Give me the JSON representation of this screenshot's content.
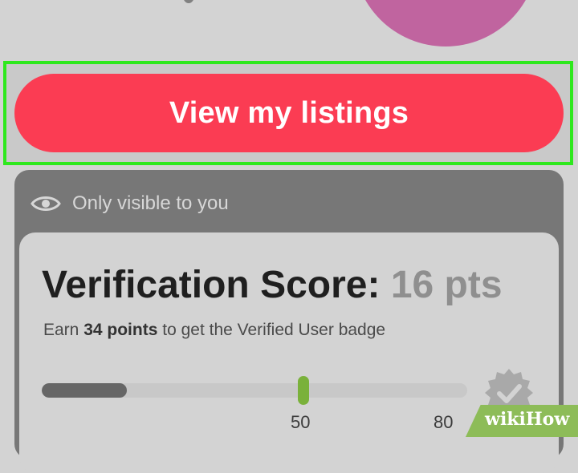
{
  "button": {
    "label": "View my listings"
  },
  "visibility": {
    "label": "Only visible to you",
    "icon": "eye-icon"
  },
  "score": {
    "title": "Verification Score:",
    "value": "16 pts",
    "progress_points": 16,
    "max_points": 80,
    "earn_prefix": "Earn",
    "earn_points": "34 points",
    "earn_suffix": "to get the Verified User badge",
    "ticks": [
      "50",
      "80"
    ]
  },
  "badge": {
    "icon": "verified-badge-icon"
  },
  "watermark": {
    "text": "wikiHow"
  },
  "colors": {
    "accent": "#fb3c53",
    "highlight": "#2ee81d",
    "marker": "#7ab13b",
    "avatar": "#c0649f"
  }
}
